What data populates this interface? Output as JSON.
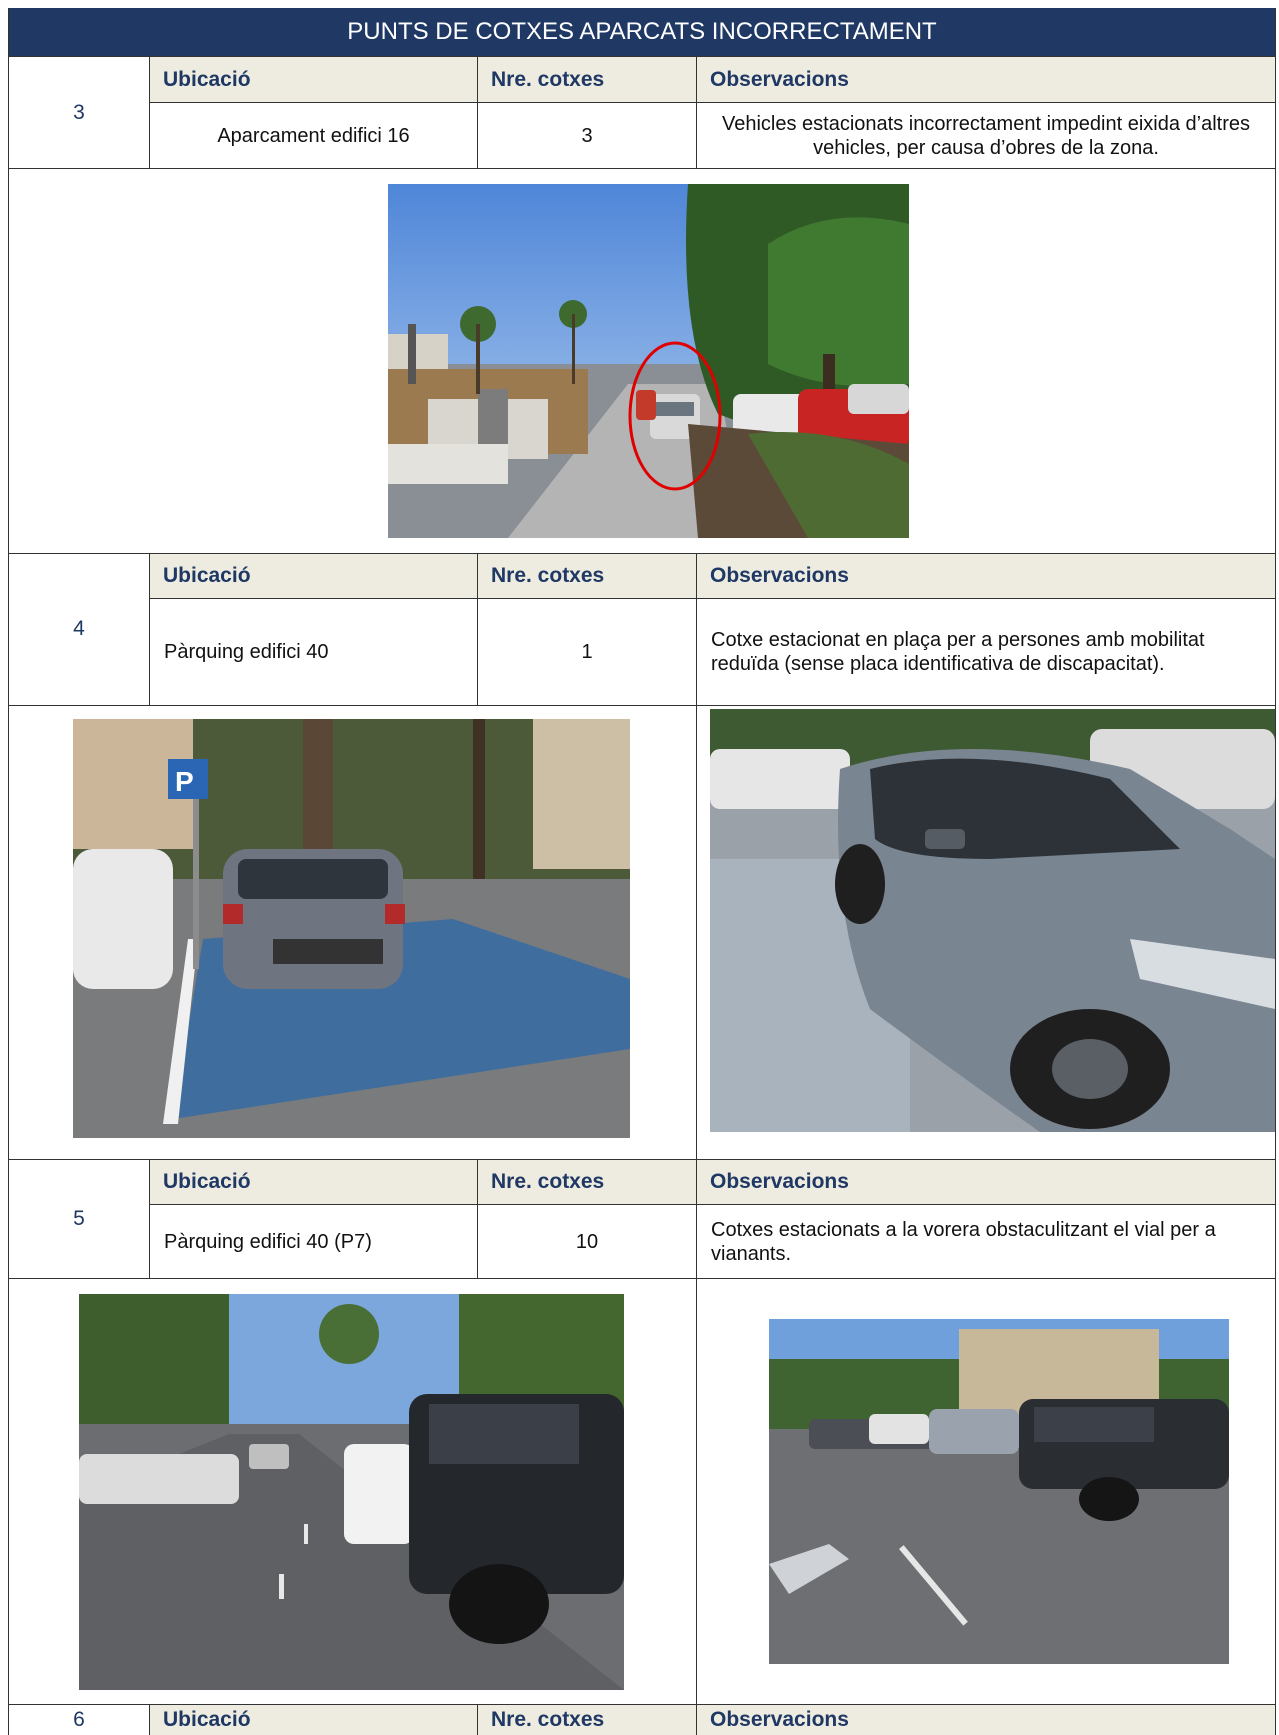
{
  "title": "PUNTS DE COTXES APARCATS INCORRECTAMENT",
  "headers": {
    "location": "Ubicació",
    "cars": "Nre. cotxes",
    "notes": "Observacions"
  },
  "entries": [
    {
      "number": "3",
      "location": "Aparcament edifici 16",
      "cars": "3",
      "notes": "Vehicles estacionats incorrectament impedint eixida d’altres vehicles, per causa d’obres de la zona."
    },
    {
      "number": "4",
      "location": "Pàrquing edifici 40",
      "cars": "1",
      "notes": "Cotxe estacionat en plaça per a persones amb mobilitat reduïda (sense placa identificativa de discapacitat)."
    },
    {
      "number": "5",
      "location": "Pàrquing edifici 40 (P7)",
      "cars": "10",
      "notes": "Cotxes estacionats a la vorera obstaculitzant el vial per a vianants."
    },
    {
      "number": "6"
    }
  ],
  "colors": {
    "title_bg": "#1f3864",
    "header_bg": "#eeece1",
    "accent_text": "#1f3864",
    "highlight_circle": "#e00000"
  }
}
